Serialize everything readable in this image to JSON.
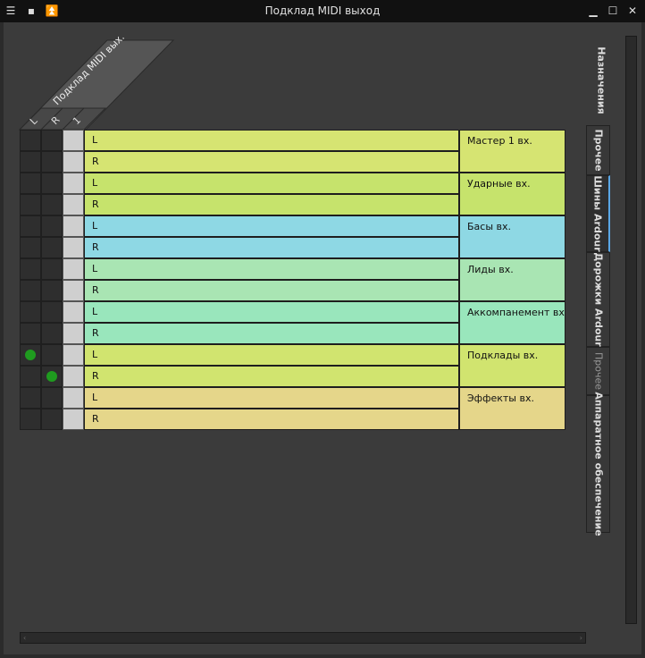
{
  "window": {
    "title": "Подклад MIDI выход"
  },
  "titlebar": {
    "menu_icon": "hamburger-icon",
    "pin_icon": "square-dot-icon",
    "up_icon": "move-up-icon",
    "minimize_icon": "minimize-icon",
    "maximize_icon": "maximize-icon",
    "close_icon": "close-icon"
  },
  "column_header": {
    "group_label": "Подклад MIDI вых.",
    "ports": [
      "L",
      "R",
      "1"
    ]
  },
  "rows": [
    {
      "bundle": "Мастер 1 вх.",
      "color": "#d6e472",
      "ports": [
        "L",
        "R"
      ]
    },
    {
      "bundle": "Ударные вх.",
      "color": "#c6e36c",
      "ports": [
        "L",
        "R"
      ]
    },
    {
      "bundle": "Басы вх.",
      "color": "#8ed8e4",
      "ports": [
        "L",
        "R"
      ]
    },
    {
      "bundle": "Лиды вх.",
      "color": "#a9e5b3",
      "ports": [
        "L",
        "R"
      ]
    },
    {
      "bundle": "Аккомпанемент вх",
      "color": "#99e6bc",
      "ports": [
        "L",
        "R"
      ]
    },
    {
      "bundle": "Подклады вх.",
      "color": "#d1e46f",
      "ports": [
        "L",
        "R"
      ]
    },
    {
      "bundle": "Эффекты вх.",
      "color": "#e5d68a",
      "ports": [
        "L",
        "R"
      ]
    }
  ],
  "connections": [
    {
      "row": 5,
      "port": 0,
      "col": 0
    },
    {
      "row": 5,
      "port": 1,
      "col": 1
    }
  ],
  "side_header": "Назначения",
  "side_tabs": [
    {
      "label": "Прочее",
      "selected": false,
      "dim": false
    },
    {
      "label": "Шины Ardour",
      "selected": true,
      "dim": false
    },
    {
      "label": "Дорожки Ardour",
      "selected": false,
      "dim": false
    },
    {
      "label": "Прочее",
      "selected": false,
      "dim": true
    },
    {
      "label": "Аппаратное обеспечение",
      "selected": false,
      "dim": false
    }
  ]
}
